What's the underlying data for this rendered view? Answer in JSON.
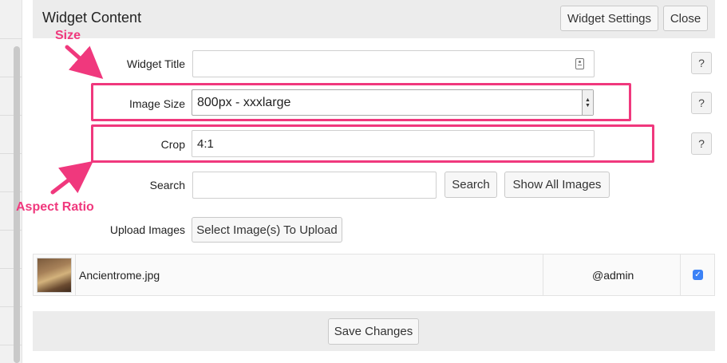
{
  "header": {
    "title": "Widget Content",
    "settings_label": "Widget Settings",
    "close_label": "Close"
  },
  "form": {
    "widget_title": {
      "label": "Widget Title",
      "value": ""
    },
    "image_size": {
      "label": "Image Size",
      "value": "800px - xxxlarge"
    },
    "crop": {
      "label": "Crop",
      "value": "4:1"
    },
    "search": {
      "label": "Search",
      "value": "",
      "button_label": "Search",
      "show_all_label": "Show All Images"
    },
    "upload": {
      "label": "Upload Images",
      "button_label": "Select Image(s) To Upload"
    },
    "help_label": "?"
  },
  "files": [
    {
      "name": "Ancientrome.jpg",
      "owner": "@admin",
      "selected": true
    }
  ],
  "footer": {
    "save_label": "Save Changes"
  },
  "annotations": {
    "size": "Size",
    "aspect_ratio": "Aspect Ratio",
    "color": "#f0387d"
  },
  "colors": {
    "header_bg": "#ececec",
    "accent_checkbox": "#3b82f6"
  }
}
